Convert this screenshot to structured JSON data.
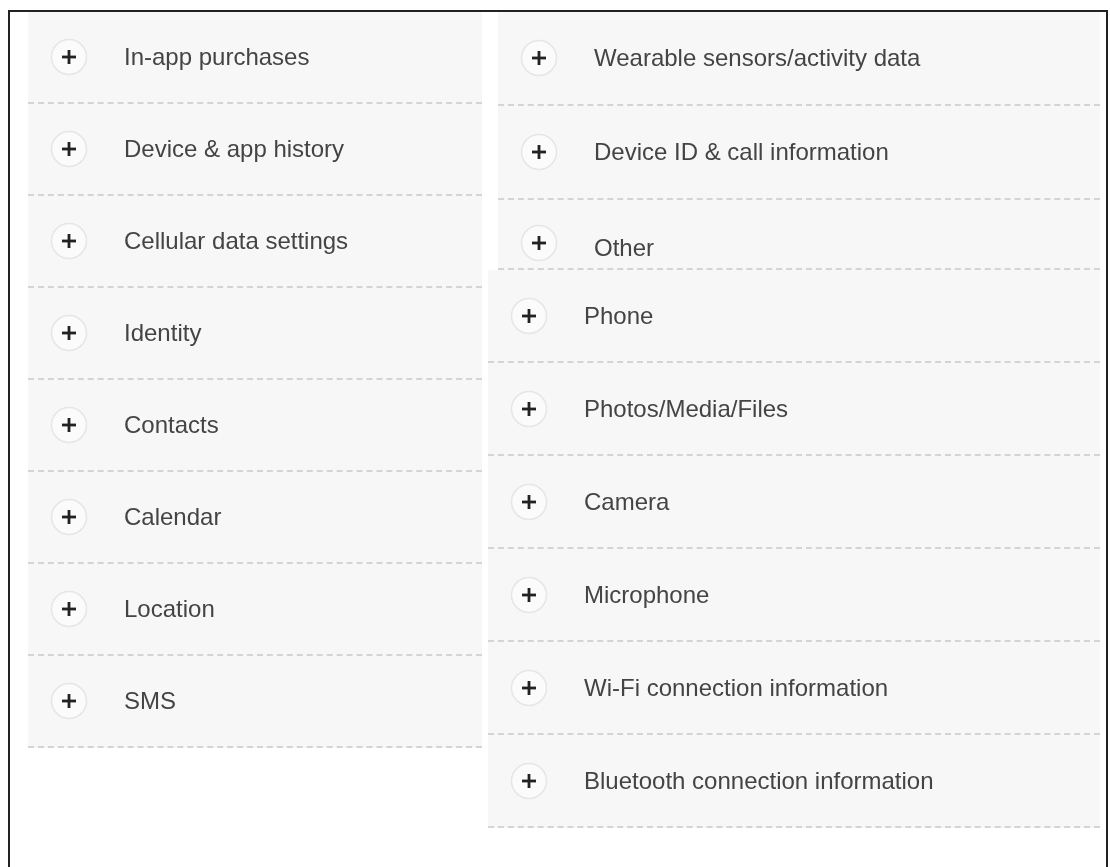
{
  "left_column": [
    {
      "label": "In-app purchases",
      "expanded": false
    },
    {
      "label": "Device & app history",
      "expanded": false
    },
    {
      "label": "Cellular data settings",
      "expanded": false
    },
    {
      "label": "Identity",
      "expanded": false
    },
    {
      "label": "Contacts",
      "expanded": false
    },
    {
      "label": "Calendar",
      "expanded": false
    },
    {
      "label": "Location",
      "expanded": false
    },
    {
      "label": "SMS",
      "expanded": false
    }
  ],
  "right_column_top": [
    {
      "label": "Wearable sensors/activity data",
      "expanded": false
    },
    {
      "label": "Device ID & call information",
      "expanded": false
    },
    {
      "label": "Other",
      "expanded": false
    }
  ],
  "right_column_bottom": [
    {
      "label": "Phone",
      "expanded": false
    },
    {
      "label": "Photos/Media/Files",
      "expanded": false
    },
    {
      "label": "Camera",
      "expanded": false
    },
    {
      "label": "Microphone",
      "expanded": false
    },
    {
      "label": "Wi-Fi connection information",
      "expanded": false
    },
    {
      "label": "Bluetooth connection information",
      "expanded": false
    }
  ]
}
